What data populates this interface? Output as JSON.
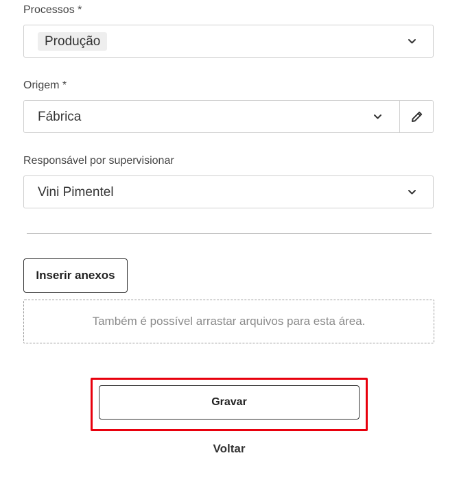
{
  "form": {
    "processos": {
      "label": "Processos *",
      "selected": "Produção",
      "icon": "chevron-down-icon"
    },
    "origem": {
      "label": "Origem *",
      "value": "Fábrica",
      "icon": "chevron-down-icon",
      "edit_icon": "pencil-icon"
    },
    "responsavel": {
      "label": "Responsável por supervisionar",
      "value": "Vini Pimentel",
      "icon": "chevron-down-icon"
    }
  },
  "attachments": {
    "button_label": "Inserir anexos",
    "dropzone_text": "Também é possível arrastar arquivos para esta área."
  },
  "actions": {
    "save_label": "Gravar",
    "back_label": "Voltar",
    "highlight_color": "#e8000d"
  }
}
